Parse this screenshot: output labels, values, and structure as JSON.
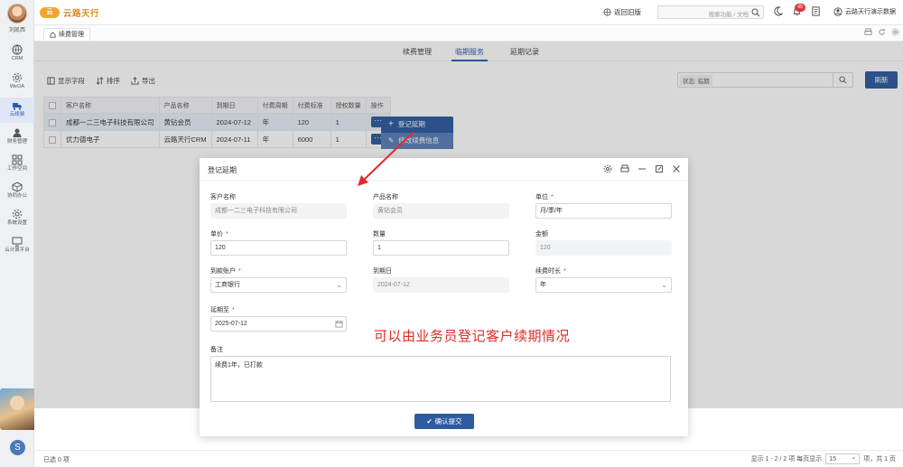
{
  "sidebar": {
    "user_name": "刘凯西",
    "items": [
      {
        "label": "CRM",
        "icon": "globe-icon"
      },
      {
        "label": "WeOA",
        "icon": "gear-icon"
      },
      {
        "label": "云续费",
        "icon": "truck-icon",
        "active": true
      },
      {
        "label": "财务管理",
        "icon": "user-icon"
      },
      {
        "label": "工作空间",
        "icon": "grid-icon"
      },
      {
        "label": "协同办公",
        "icon": "box-icon"
      },
      {
        "label": "系统设置",
        "icon": "gear-icon"
      },
      {
        "label": "云计算平台",
        "icon": "screen-icon"
      }
    ]
  },
  "header": {
    "logo_mark": "云",
    "logo_text": "云路天行",
    "old_version": "返回旧版",
    "search_placeholder": "搜索功能 / 文档",
    "badge_count": "45",
    "user_text": "云路天行演示数据"
  },
  "tabstrip": {
    "page_tab": "续费管理"
  },
  "subtabs": [
    "续费管理",
    "临期服务",
    "延期记录"
  ],
  "toolbar": {
    "show_fields": "显示字段",
    "sort": "排序",
    "export": "导出"
  },
  "filter": {
    "tag": "状态: 临期",
    "reset": "刷新"
  },
  "table": {
    "headers": [
      "客户名称",
      "产品名称",
      "到期日",
      "付费周期",
      "付费标准",
      "授权数量",
      "操作"
    ],
    "rows": [
      [
        "成都一二三电子科技有限公司",
        "黄钻会员",
        "2024-07-12",
        "年",
        "120",
        "1"
      ],
      [
        "优力德电子",
        "云路天行CRM",
        "2024-07-11",
        "年",
        "6000",
        "1"
      ]
    ]
  },
  "popmenu": {
    "item1": "登记延期",
    "item2": "修改续费信息"
  },
  "footer": {
    "selected": "已选 0 项",
    "display": "显示 1 - 2 / 2 项  每页显示",
    "page_size": "15",
    "total": "项，共 1 页"
  },
  "modal": {
    "title": "登记延期",
    "fields": {
      "customer": {
        "label": "客户名称",
        "value": "成都一二三电子科技有限公司"
      },
      "product": {
        "label": "产品名称",
        "value": "黄钻会员"
      },
      "unit": {
        "label": "单位",
        "value": "月/季/年"
      },
      "price": {
        "label": "单价",
        "value": "120"
      },
      "quantity": {
        "label": "数量",
        "value": "1"
      },
      "amount": {
        "label": "金额",
        "value": "120"
      },
      "account": {
        "label": "到款账户",
        "value": "工商银行"
      },
      "expire": {
        "label": "到期日",
        "value": "2024-07-12"
      },
      "duration": {
        "label": "续费时长",
        "value": "年"
      },
      "extend_to": {
        "label": "延期至",
        "value": "2025-07-12"
      },
      "remark": {
        "label": "备注",
        "value": "续费1年，已打款"
      }
    },
    "submit": "确认提交"
  },
  "annotation": "可以由业务员登记客户续期情况",
  "colors": {
    "primary": "#2d5b9f",
    "annotation": "#e12b2b",
    "badge": "#e33b3b",
    "logo": "#f1a531"
  }
}
